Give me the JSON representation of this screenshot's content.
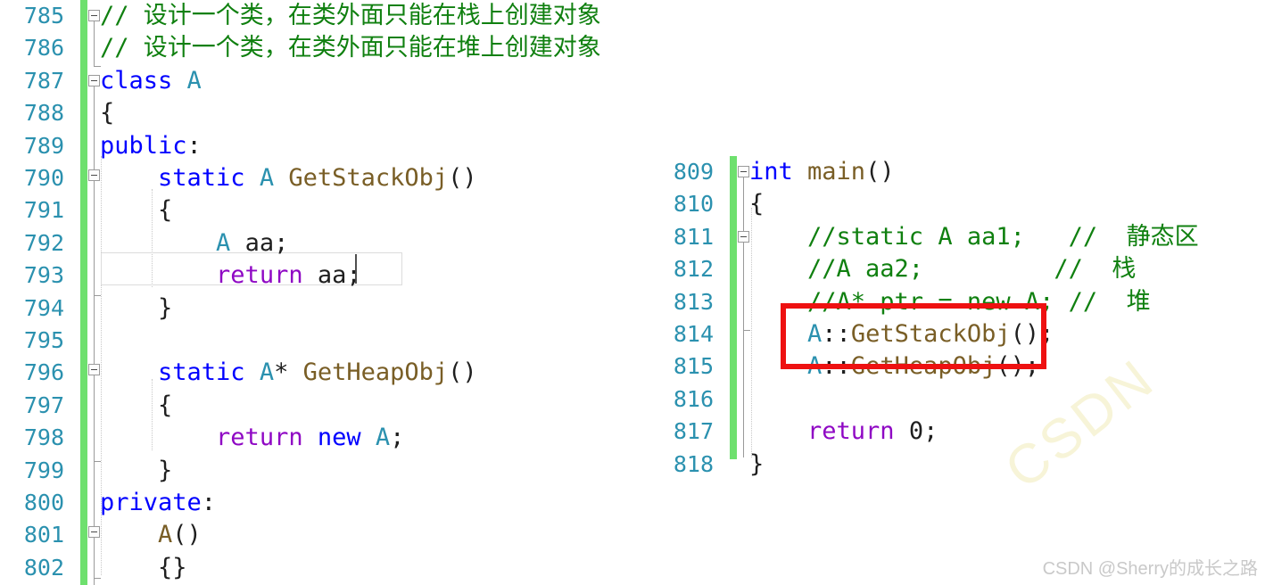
{
  "app": {
    "kind": "code-editor-screenshot",
    "accent_green_changebar": "#6ee06e",
    "lineno_color": "#2b91af",
    "annotation_color": "#ee1111"
  },
  "left_pane": {
    "name": "class-definition-pane",
    "first_line": 785,
    "lines": [
      {
        "no": "785",
        "segments": [
          {
            "text": "// 设计一个类，在类外面只能在栈上创建对象",
            "cls": "t-cmt"
          }
        ]
      },
      {
        "no": "786",
        "segments": [
          {
            "text": "// 设计一个类，在类外面只能在堆上创建对象",
            "cls": "t-cmt"
          }
        ]
      },
      {
        "no": "787",
        "segments": [
          {
            "text": "class ",
            "cls": "t-kw"
          },
          {
            "text": "A",
            "cls": "t-type"
          }
        ]
      },
      {
        "no": "788",
        "segments": [
          {
            "text": "{",
            "cls": "t-plain"
          }
        ]
      },
      {
        "no": "789",
        "segments": [
          {
            "text": "public",
            "cls": "t-kw"
          },
          {
            "text": ":",
            "cls": "t-plain"
          }
        ]
      },
      {
        "no": "790",
        "segments": [
          {
            "text": "    ",
            "cls": "t-plain"
          },
          {
            "text": "static ",
            "cls": "t-kw"
          },
          {
            "text": "A",
            "cls": "t-type"
          },
          {
            "text": " ",
            "cls": "t-plain"
          },
          {
            "text": "GetStackObj",
            "cls": "t-fn"
          },
          {
            "text": "()",
            "cls": "t-plain"
          }
        ]
      },
      {
        "no": "791",
        "segments": [
          {
            "text": "    {",
            "cls": "t-plain"
          }
        ]
      },
      {
        "no": "792",
        "segments": [
          {
            "text": "        ",
            "cls": "t-plain"
          },
          {
            "text": "A",
            "cls": "t-type"
          },
          {
            "text": " aa;",
            "cls": "t-plain"
          }
        ]
      },
      {
        "no": "793",
        "segments": [
          {
            "text": "        ",
            "cls": "t-plain"
          },
          {
            "text": "return",
            "cls": "t-ctl"
          },
          {
            "text": " aa;",
            "cls": "t-plain"
          }
        ]
      },
      {
        "no": "794",
        "segments": [
          {
            "text": "    }",
            "cls": "t-plain"
          }
        ]
      },
      {
        "no": "795",
        "segments": [
          {
            "text": "",
            "cls": "t-plain"
          }
        ]
      },
      {
        "no": "796",
        "segments": [
          {
            "text": "    ",
            "cls": "t-plain"
          },
          {
            "text": "static ",
            "cls": "t-kw"
          },
          {
            "text": "A",
            "cls": "t-type"
          },
          {
            "text": "* ",
            "cls": "t-plain"
          },
          {
            "text": "GetHeapObj",
            "cls": "t-fn"
          },
          {
            "text": "()",
            "cls": "t-plain"
          }
        ]
      },
      {
        "no": "797",
        "segments": [
          {
            "text": "    {",
            "cls": "t-plain"
          }
        ]
      },
      {
        "no": "798",
        "segments": [
          {
            "text": "        ",
            "cls": "t-plain"
          },
          {
            "text": "return ",
            "cls": "t-ctl"
          },
          {
            "text": "new ",
            "cls": "t-kw"
          },
          {
            "text": "A",
            "cls": "t-type"
          },
          {
            "text": ";",
            "cls": "t-plain"
          }
        ]
      },
      {
        "no": "799",
        "segments": [
          {
            "text": "    }",
            "cls": "t-plain"
          }
        ]
      },
      {
        "no": "800",
        "segments": [
          {
            "text": "private",
            "cls": "t-kw"
          },
          {
            "text": ":",
            "cls": "t-plain"
          }
        ]
      },
      {
        "no": "801",
        "segments": [
          {
            "text": "    ",
            "cls": "t-plain"
          },
          {
            "text": "A",
            "cls": "t-fn"
          },
          {
            "text": "()",
            "cls": "t-plain"
          }
        ]
      },
      {
        "no": "802",
        "segments": [
          {
            "text": "    {}",
            "cls": "t-plain"
          }
        ]
      }
    ],
    "current_line_no": "793",
    "caret_after_text": "return aa;"
  },
  "right_pane": {
    "name": "main-function-pane",
    "first_line": 809,
    "lines": [
      {
        "no": "809",
        "segments": [
          {
            "text": "int ",
            "cls": "t-kw"
          },
          {
            "text": "main",
            "cls": "t-fn"
          },
          {
            "text": "()",
            "cls": "t-plain"
          }
        ]
      },
      {
        "no": "810",
        "segments": [
          {
            "text": "{",
            "cls": "t-plain"
          }
        ]
      },
      {
        "no": "811",
        "segments": [
          {
            "text": "    //static A aa1;   //  静态区",
            "cls": "t-cmt"
          }
        ]
      },
      {
        "no": "812",
        "segments": [
          {
            "text": "    //A aa2;         //  栈",
            "cls": "t-cmt"
          }
        ]
      },
      {
        "no": "813",
        "segments": [
          {
            "text": "    //A* ptr = new A; //  堆",
            "cls": "t-cmt"
          }
        ]
      },
      {
        "no": "814",
        "segments": [
          {
            "text": "    ",
            "cls": "t-plain"
          },
          {
            "text": "A",
            "cls": "t-type"
          },
          {
            "text": "::",
            "cls": "t-plain"
          },
          {
            "text": "GetStackObj",
            "cls": "t-fn"
          },
          {
            "text": "();",
            "cls": "t-plain"
          }
        ]
      },
      {
        "no": "815",
        "segments": [
          {
            "text": "    ",
            "cls": "t-plain"
          },
          {
            "text": "A",
            "cls": "t-type"
          },
          {
            "text": "::",
            "cls": "t-plain"
          },
          {
            "text": "GetHeapObj",
            "cls": "t-fn"
          },
          {
            "text": "();",
            "cls": "t-plain"
          }
        ]
      },
      {
        "no": "816",
        "segments": [
          {
            "text": "",
            "cls": "t-plain"
          }
        ]
      },
      {
        "no": "817",
        "segments": [
          {
            "text": "    ",
            "cls": "t-plain"
          },
          {
            "text": "return ",
            "cls": "t-ctl"
          },
          {
            "text": "0",
            "cls": "t-num"
          },
          {
            "text": ";",
            "cls": "t-plain"
          }
        ]
      },
      {
        "no": "818",
        "segments": [
          {
            "text": "}",
            "cls": "t-plain"
          }
        ]
      }
    ]
  },
  "annotation": {
    "name": "red-highlight-rectangle",
    "covers_lines": [
      "814",
      "815"
    ],
    "color": "#ee1111"
  },
  "watermarks": {
    "corner_text": "CSDN @Sherry的成长之路",
    "diagonal_text": "CSDN"
  }
}
